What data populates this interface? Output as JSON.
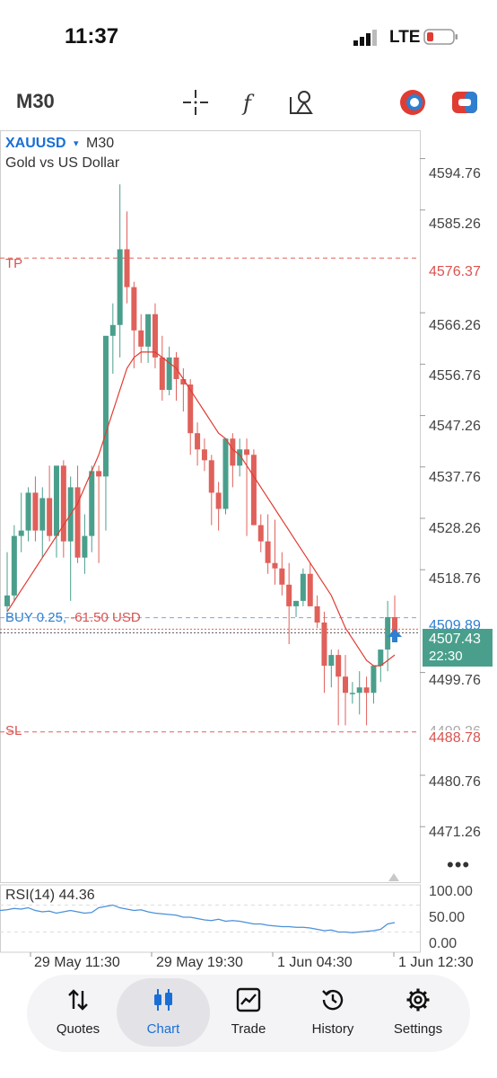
{
  "status_bar": {
    "time": "11:37",
    "network": "LTE"
  },
  "toolbar": {
    "timeframe": "M30",
    "icons": [
      "crosshair-icon",
      "indicators-icon",
      "objects-icon",
      "account-icon",
      "trade-icon"
    ]
  },
  "symbol": {
    "ticker": "XAUUSD",
    "arrow": "▾",
    "timeframe": "M30",
    "description": "Gold vs US Dollar"
  },
  "price_axis": [
    "4594.76",
    "4585.26",
    "4576.37",
    "4566.26",
    "4556.76",
    "4547.26",
    "4537.76",
    "4528.26",
    "4518.76",
    "4509.89",
    "4499.76",
    "4490.26",
    "4488.78",
    "4480.76",
    "4471.26"
  ],
  "levels": {
    "tp": {
      "label": "TP",
      "price": "4576.37"
    },
    "sl": {
      "label": "SL",
      "price": "4488.78"
    },
    "position": {
      "side": "BUY 0.25,",
      "pnl": "-61.50 USD",
      "price": "4509.89"
    }
  },
  "current_price": {
    "price": "4507.43",
    "countdown": "22:30"
  },
  "rsi": {
    "label": "RSI(14) 44.36",
    "ticks": [
      "100.00",
      "50.00",
      "0.00"
    ]
  },
  "time_axis": [
    "29 May 11:30",
    "29 May 19:30",
    "1 Jun 04:30",
    "1 Jun 12:30"
  ],
  "tabs": [
    {
      "label": "Quotes",
      "icon": "quotes-icon",
      "active": false
    },
    {
      "label": "Chart",
      "icon": "chart-icon",
      "active": true
    },
    {
      "label": "Trade",
      "icon": "trade-tab-icon",
      "active": false
    },
    {
      "label": "History",
      "icon": "history-icon",
      "active": false
    },
    {
      "label": "Settings",
      "icon": "settings-icon",
      "active": false
    }
  ],
  "colors": {
    "bull": "#4a9f8c",
    "bear": "#e0605a",
    "ma": "#e03c32",
    "rsi": "#4a90d9",
    "accent": "#1a6fd6"
  },
  "chart_data": {
    "type": "candlestick",
    "symbol": "XAUUSD",
    "timeframe": "M30",
    "candles": [
      {
        "o": 4512,
        "h": 4522,
        "l": 4511,
        "c": 4514
      },
      {
        "o": 4514,
        "h": 4527,
        "l": 4513,
        "c": 4525
      },
      {
        "o": 4525,
        "h": 4533,
        "l": 4522,
        "c": 4526
      },
      {
        "o": 4526,
        "h": 4534,
        "l": 4524,
        "c": 4533
      },
      {
        "o": 4533,
        "h": 4536,
        "l": 4524,
        "c": 4526
      },
      {
        "o": 4526,
        "h": 4534,
        "l": 4521,
        "c": 4532
      },
      {
        "o": 4532,
        "h": 4538,
        "l": 4524,
        "c": 4525
      },
      {
        "o": 4525,
        "h": 4536,
        "l": 4521,
        "c": 4538
      },
      {
        "o": 4538,
        "h": 4539,
        "l": 4521,
        "c": 4524
      },
      {
        "o": 4524,
        "h": 4536,
        "l": 4513,
        "c": 4534
      },
      {
        "o": 4534,
        "h": 4538,
        "l": 4520,
        "c": 4521
      },
      {
        "o": 4521,
        "h": 4529,
        "l": 4518,
        "c": 4525
      },
      {
        "o": 4525,
        "h": 4538,
        "l": 4522,
        "c": 4537
      },
      {
        "o": 4537,
        "h": 4538,
        "l": 4520,
        "c": 4536
      },
      {
        "o": 4536,
        "h": 4562,
        "l": 4526,
        "c": 4562
      },
      {
        "o": 4562,
        "h": 4568,
        "l": 4555,
        "c": 4564
      },
      {
        "o": 4564,
        "h": 4590,
        "l": 4558,
        "c": 4578
      },
      {
        "o": 4578,
        "h": 4585,
        "l": 4568,
        "c": 4571
      },
      {
        "o": 4571,
        "h": 4572,
        "l": 4556,
        "c": 4563
      },
      {
        "o": 4563,
        "h": 4566,
        "l": 4557,
        "c": 4560
      },
      {
        "o": 4560,
        "h": 4565,
        "l": 4557,
        "c": 4566
      },
      {
        "o": 4566,
        "h": 4568,
        "l": 4556,
        "c": 4558
      },
      {
        "o": 4558,
        "h": 4562,
        "l": 4550,
        "c": 4552
      },
      {
        "o": 4552,
        "h": 4560,
        "l": 4551,
        "c": 4558
      },
      {
        "o": 4558,
        "h": 4559,
        "l": 4550,
        "c": 4554
      },
      {
        "o": 4554,
        "h": 4556,
        "l": 4548,
        "c": 4553
      },
      {
        "o": 4553,
        "h": 4554,
        "l": 4540,
        "c": 4544
      },
      {
        "o": 4544,
        "h": 4546,
        "l": 4538,
        "c": 4541
      },
      {
        "o": 4541,
        "h": 4543,
        "l": 4537,
        "c": 4539
      },
      {
        "o": 4539,
        "h": 4540,
        "l": 4527,
        "c": 4533
      },
      {
        "o": 4533,
        "h": 4535,
        "l": 4526,
        "c": 4530
      },
      {
        "o": 4530,
        "h": 4540,
        "l": 4529,
        "c": 4543
      },
      {
        "o": 4543,
        "h": 4544,
        "l": 4534,
        "c": 4538
      },
      {
        "o": 4538,
        "h": 4543,
        "l": 4536,
        "c": 4541
      },
      {
        "o": 4541,
        "h": 4543,
        "l": 4525,
        "c": 4540
      },
      {
        "o": 4540,
        "h": 4541,
        "l": 4527,
        "c": 4527
      },
      {
        "o": 4527,
        "h": 4529,
        "l": 4522,
        "c": 4524
      },
      {
        "o": 4524,
        "h": 4529,
        "l": 4518,
        "c": 4520
      },
      {
        "o": 4520,
        "h": 4528,
        "l": 4516,
        "c": 4519
      },
      {
        "o": 4519,
        "h": 4522,
        "l": 4514,
        "c": 4516
      },
      {
        "o": 4516,
        "h": 4520,
        "l": 4505,
        "c": 4512
      },
      {
        "o": 4512,
        "h": 4513,
        "l": 4510,
        "c": 4513
      },
      {
        "o": 4513,
        "h": 4519,
        "l": 4512,
        "c": 4518
      },
      {
        "o": 4518,
        "h": 4520,
        "l": 4512,
        "c": 4512
      },
      {
        "o": 4512,
        "h": 4514,
        "l": 4508,
        "c": 4509
      },
      {
        "o": 4509,
        "h": 4511,
        "l": 4496,
        "c": 4501
      },
      {
        "o": 4501,
        "h": 4504,
        "l": 4497,
        "c": 4503
      },
      {
        "o": 4503,
        "h": 4504,
        "l": 4490,
        "c": 4499
      },
      {
        "o": 4499,
        "h": 4503,
        "l": 4490,
        "c": 4496
      },
      {
        "o": 4496,
        "h": 4498,
        "l": 4494,
        "c": 4496
      },
      {
        "o": 4496,
        "h": 4500,
        "l": 4492,
        "c": 4497
      },
      {
        "o": 4497,
        "h": 4499,
        "l": 4490,
        "c": 4496
      },
      {
        "o": 4496,
        "h": 4500,
        "l": 4494,
        "c": 4501
      },
      {
        "o": 4501,
        "h": 4503,
        "l": 4498,
        "c": 4504
      },
      {
        "o": 4504,
        "h": 4513,
        "l": 4500,
        "c": 4510
      },
      {
        "o": 4510,
        "h": 4514,
        "l": 4507,
        "c": 4507
      }
    ],
    "ma": [
      4511,
      4513,
      4515,
      4517,
      4519,
      4521,
      4523,
      4525,
      4527,
      4529,
      4531,
      4534,
      4537,
      4540,
      4544,
      4548,
      4552,
      4556,
      4558,
      4559,
      4559,
      4559,
      4558,
      4557,
      4556,
      4554,
      4552,
      4550,
      4548,
      4546,
      4544,
      4543,
      4541,
      4540,
      4538,
      4536,
      4534,
      4532,
      4530,
      4528,
      4526,
      4524,
      4522,
      4520,
      4518,
      4516,
      4514,
      4511,
      4508,
      4506,
      4504,
      4502,
      4501,
      4501,
      4502,
      4503
    ],
    "rsi": [
      62,
      63,
      65,
      64,
      66,
      62,
      60,
      61,
      58,
      60,
      62,
      60,
      58,
      59,
      66,
      68,
      70,
      66,
      64,
      62,
      63,
      60,
      58,
      57,
      56,
      55,
      52,
      52,
      50,
      48,
      47,
      49,
      46,
      47,
      46,
      44,
      42,
      42,
      40,
      39,
      38,
      38,
      37,
      37,
      36,
      34,
      32,
      33,
      30,
      30,
      29,
      30,
      31,
      32,
      34,
      42,
      44
    ]
  }
}
